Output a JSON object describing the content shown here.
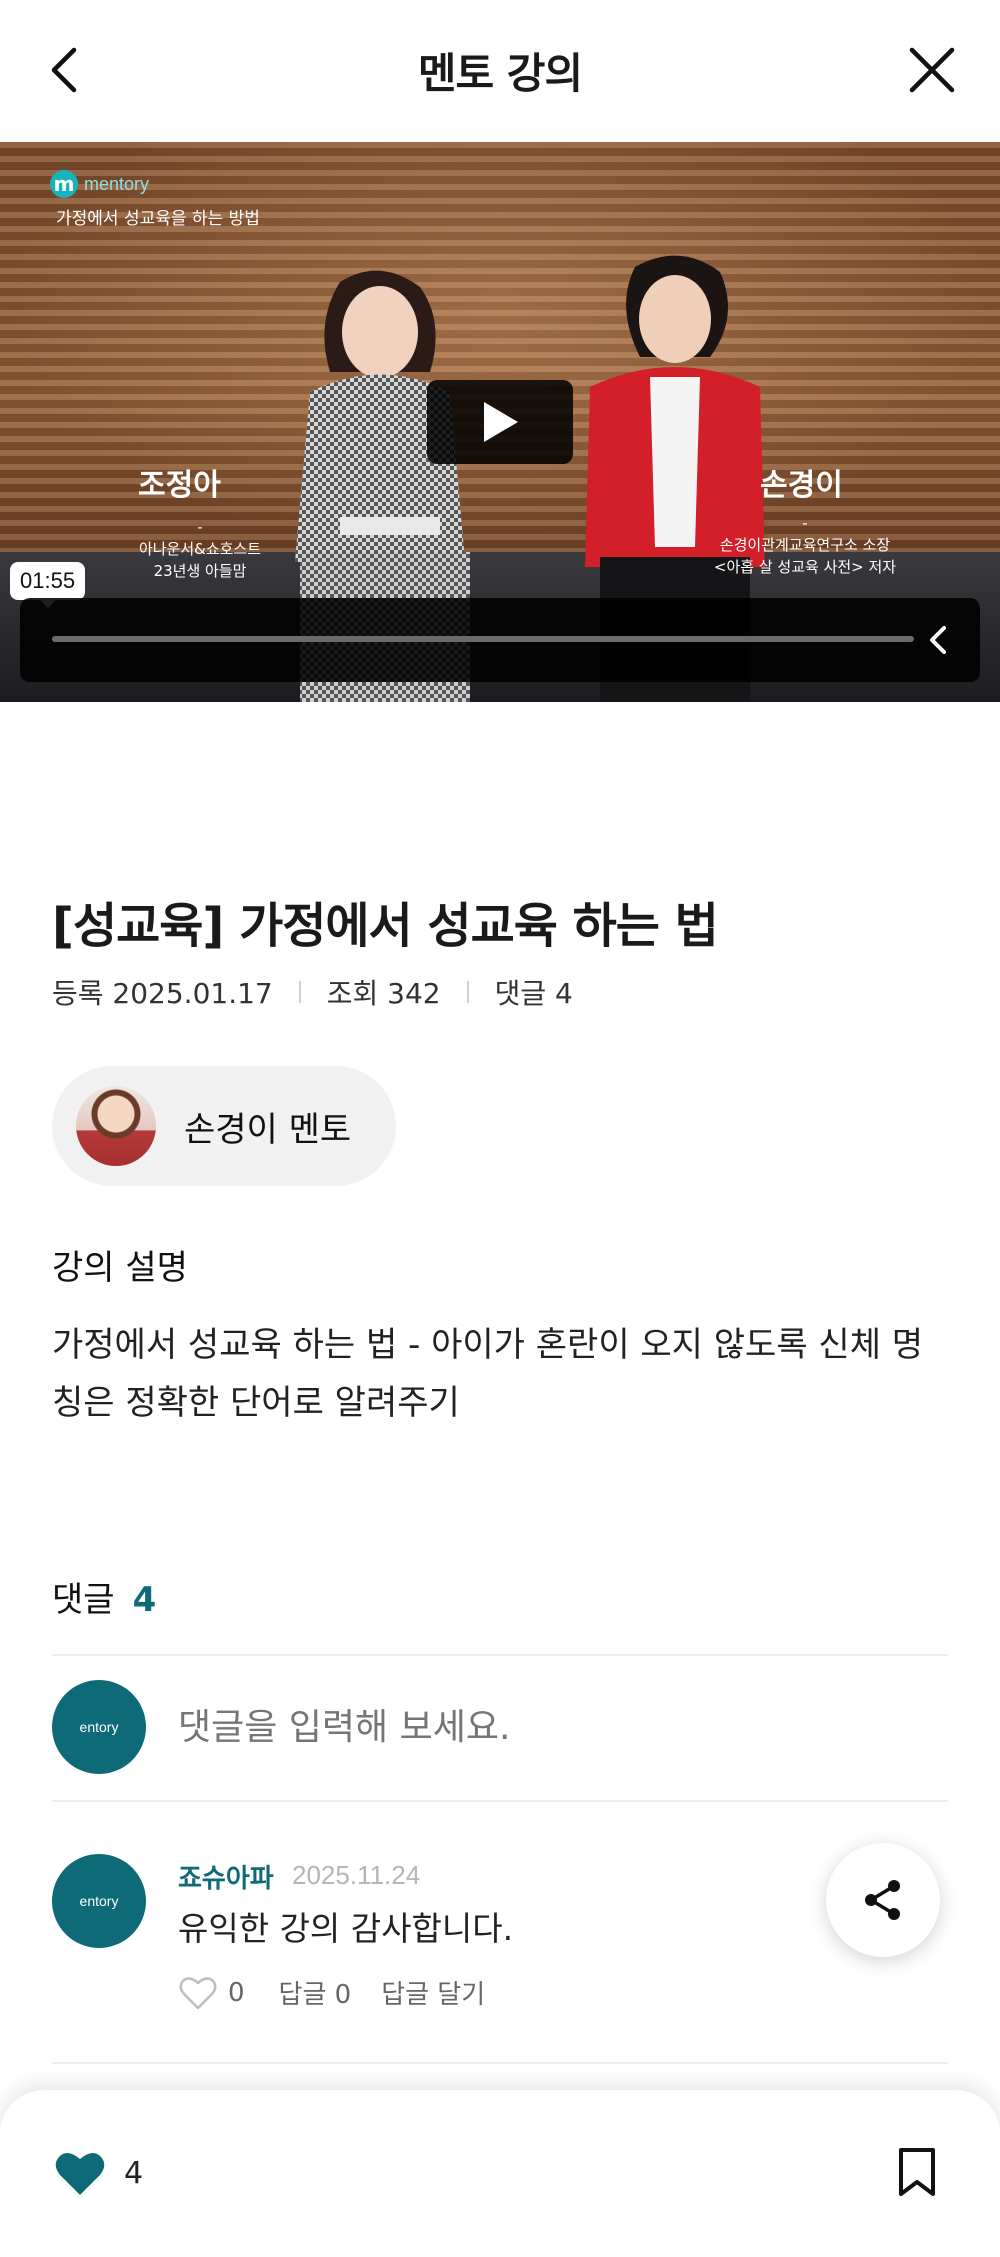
{
  "header": {
    "title": "멘토 강의",
    "back_icon": "chevron-left-icon",
    "close_icon": "close-icon"
  },
  "video": {
    "brand_mark": "m",
    "brand_word": "mentory",
    "caption": "가정에서 성교육을 하는 방법",
    "left_person_name": "조정아",
    "left_person_sub1": "아나운서&쇼호스트",
    "left_person_sub2": "23년생 아들맘",
    "right_person_name": "손경이",
    "right_person_sub1": "손경이관계교육연구소 소장",
    "right_person_sub2": "<아홉 살 성교육 사전> 저자",
    "time": "01:55",
    "play_icon": "play-icon",
    "collapse_icon": "chevron-left-icon",
    "progress": 0.0
  },
  "lecture": {
    "title": "[성교육] 가정에서 성교육 하는 법",
    "registered": "등록 2025.01.17",
    "views": "조회 342",
    "comments": "댓글 4"
  },
  "mentor": {
    "name": "손경이 멘토"
  },
  "description": {
    "heading": "강의 설명",
    "body": "가정에서 성교육 하는 법 - 아이가 혼란이 오지 않도록 신체 명칭은 정확한 단어로 알려주기"
  },
  "comments": {
    "heading": "댓글",
    "count": "4",
    "input_placeholder": "댓글을 입력해 보세요.",
    "avatar_text": "entory",
    "items": [
      {
        "author": "죠슈아파",
        "date": "2025.11.24",
        "text": "유익한 강의 감사합니다.",
        "likes": "0",
        "replies": "답글 0",
        "reply_action": "답글 달기"
      }
    ]
  },
  "fab": {
    "icon": "share-icon"
  },
  "bottom_bar": {
    "like_icon": "heart-filled-icon",
    "like_count": "4",
    "bookmark_icon": "bookmark-icon"
  },
  "colors": {
    "accent": "#0f6a78",
    "muted": "#9a9a9a"
  }
}
